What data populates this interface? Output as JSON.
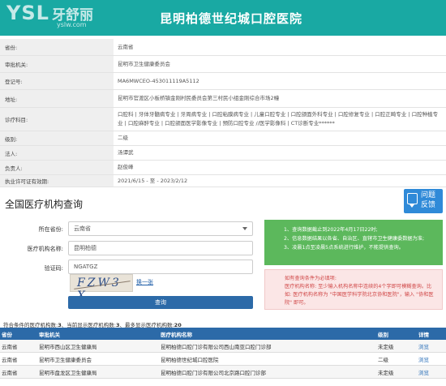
{
  "header": {
    "logo_latin": "YSL",
    "logo_cn": "牙舒丽",
    "logo_url": "yslw.com",
    "title": "昆明柏德世纪城口腔医院"
  },
  "info_rows": [
    {
      "label": "省份:",
      "value": "云南省"
    },
    {
      "label": "审批机关:",
      "value": "昆明市卫生健康委员会"
    },
    {
      "label": "登记号:",
      "value": "MA6MWCEO-453011119A5112"
    },
    {
      "label": "地址:",
      "value": "昆明市官渡区小板桥镇金刚村民委员会第三村民小组金刚综合市场2幢"
    },
    {
      "label": "诊疗科目:",
      "value": "口腔科 | 牙体牙髓病专业 | 牙周病专业 | 口腔粘膜病专业 | 儿童口腔专业 | 口腔颌面外科专业 | 口腔修复专业 | 口腔正畸专业 | 口腔种植专业 | 口腔麻醉专业 | 口腔颌面医学影像专业 | 预防口腔专业 //医学影像科 | CT诊断专业******"
    },
    {
      "label": "级别:",
      "value": "二级"
    },
    {
      "label": "法人:",
      "value": "汤谭武"
    },
    {
      "label": "负责人:",
      "value": "赵俊峰"
    },
    {
      "label": "执业许可证有效期:",
      "value": "2021/6/15 - 至 - 2023/2/12"
    }
  ],
  "query": {
    "title": "全国医疗机构查询",
    "feedback_line1": "问题",
    "feedback_line2": "反馈",
    "province_label": "所在省份:",
    "province_value": "云南省",
    "name_label": "医疗机构名称:",
    "name_value": "昆明柏德",
    "code_label": "验证码:",
    "code_value": "NGATGZ",
    "captcha_text": "FZW3 X",
    "refresh_label": "换一张",
    "submit_label": "查询"
  },
  "notice": [
    "1、查询数据截止到2022年4月17日22时;",
    "2、信息数据结果以各省、自治区、直辖市卫生健康委数据为准;",
    "3、凌晨1点至凌晨5点系统进行维护，不能提供查询。"
  ],
  "tips": {
    "line1": "如有查询条件为必填项:",
    "line2": "医疗机构名称: 至少输入机构名称中连续的4个字即可模糊查询。比如: 医疗机构名称为 \"中国医学科学院北京协和医院\"，输入 \"协和医院\" 即可。"
  },
  "summary": {
    "prefix": "符合条件的医疗机构数:",
    "match_count": "3",
    "mid1": "、当前显示医疗机构数:",
    "shown_count": "3",
    "mid2": "、最多显示医疗机构数:",
    "max_count": "20"
  },
  "table": {
    "headers": [
      "省份",
      "审批机关",
      "医疗机构名称",
      "级别",
      "详情"
    ],
    "rows": [
      [
        "云南省",
        "昆明市西山区卫生健康局",
        "昆明柏德口腔门诊有限公司西山南亚口腔门诊部",
        "未定级",
        "浏览"
      ],
      [
        "云南省",
        "昆明市卫生健康委员会",
        "昆明柏德世纪城口腔医院",
        "二级",
        "浏览"
      ],
      [
        "云南省",
        "昆明市盘龙区卫生健康局",
        "昆明柏德口腔门诊有限公司北京路口腔门诊部",
        "未定级",
        "浏览"
      ]
    ]
  },
  "colors": {
    "header_bg": "#19a9a3",
    "primary_blue": "#2c6aa8",
    "notice_green": "#5cb85c",
    "tips_red": "#d04848"
  }
}
